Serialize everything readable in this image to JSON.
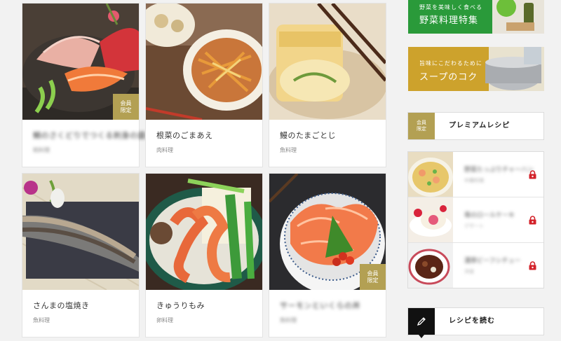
{
  "recipes": [
    {
      "title": "鯛のさくどりでつくる刺身の盛合",
      "category": "和料理",
      "member_badge": "会員\n限定",
      "blurred": true
    },
    {
      "title": "根菜のごまあえ",
      "category": "肉料理",
      "blurred": false
    },
    {
      "title": "鰻のたまごとじ",
      "category": "魚料理",
      "blurred": false
    },
    {
      "title": "さんまの塩焼き",
      "category": "魚料理",
      "blurred": false
    },
    {
      "title": "きゅうりもみ",
      "category": "卵料理",
      "blurred": false
    },
    {
      "title": "サーモンといくらの丼",
      "category": "魚料理",
      "member_badge": "会員\n限定",
      "blurred": true
    }
  ],
  "banners": [
    {
      "caption": "野菜を美味しく食べる",
      "title": "野菜料理特集"
    },
    {
      "caption": "旨味にこだわるために",
      "title": "スープのコク"
    }
  ],
  "premium": {
    "badge": "会員\n限定",
    "heading": "プレミアムレシピ",
    "items": [
      {
        "title": "野菜たっぷりチャーハン",
        "category": "中華料理"
      },
      {
        "title": "苺のロールケーキ",
        "category": "デザート"
      },
      {
        "title": "濃厚ビーフシチュー",
        "category": "洋食"
      }
    ]
  },
  "read_recipe": {
    "heading": "レシピを読む",
    "icon": "pencil-icon"
  },
  "colors": {
    "gold": "#b3a053",
    "lock_red": "#d3222a",
    "black": "#111111"
  }
}
